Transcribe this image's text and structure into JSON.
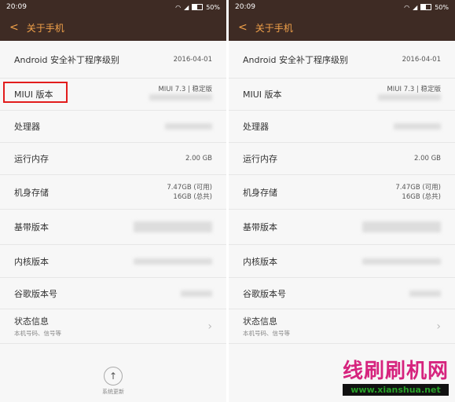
{
  "status": {
    "time": "20:09",
    "battery": "50%"
  },
  "header": {
    "title": "关于手机"
  },
  "rows": [
    {
      "label": "Android 安全补丁程序级别",
      "value": "2016-04-01",
      "value2": ""
    },
    {
      "label": "MIUI 版本",
      "value": "MIUI 7.3 | 稳定版",
      "value2": ""
    },
    {
      "label": "处理器",
      "value": "",
      "value2": ""
    },
    {
      "label": "运行内存",
      "value": "2.00 GB",
      "value2": ""
    },
    {
      "label": "机身存储",
      "value": "7.47GB (可用)",
      "value2": "16GB (总共)"
    },
    {
      "label": "基带版本",
      "value": "",
      "value2": ""
    },
    {
      "label": "内核版本",
      "value": "",
      "value2": ""
    },
    {
      "label": "谷歌版本号",
      "value": "",
      "value2": ""
    },
    {
      "label": "状态信息",
      "value": "",
      "value2": "",
      "sub": "本机号码、信号等"
    }
  ],
  "update": {
    "label": "系统更新"
  },
  "watermark": {
    "line1": "线刷刷机网",
    "line2": "www.xianshua.net"
  }
}
